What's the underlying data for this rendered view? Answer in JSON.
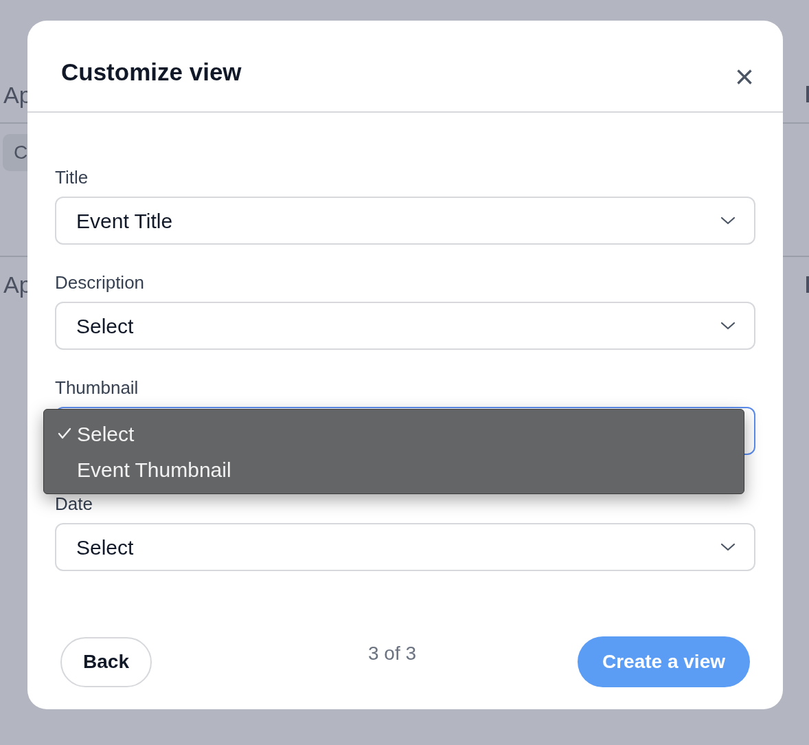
{
  "background": {
    "header_text": "Ap",
    "chip": "C",
    "row_text": "Ap"
  },
  "dialog": {
    "title": "Customize view",
    "close": "×",
    "fields": [
      {
        "label": "Title",
        "value": "Event Title",
        "focused": false
      },
      {
        "label": "Description",
        "value": "Select",
        "focused": false
      },
      {
        "label": "Thumbnail",
        "focused": true,
        "open": true,
        "options": [
          {
            "label": "Select",
            "selected": true
          },
          {
            "label": "Event Thumbnail",
            "selected": false
          }
        ]
      },
      {
        "label": "Date",
        "value": "Select",
        "focused": false
      }
    ],
    "footer": {
      "back": "Back",
      "step": "3 of 3",
      "primary": "Create a view"
    }
  }
}
